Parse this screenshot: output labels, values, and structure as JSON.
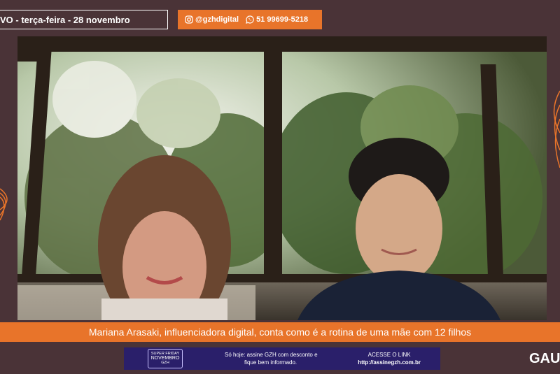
{
  "header": {
    "date_text": "VO - terça-feira - 28 novembro",
    "instagram_handle": "@gzhdigital",
    "whatsapp_number": "51 99699-5218",
    "icons": [
      "instagram-icon",
      "whatsapp-icon"
    ]
  },
  "caption": "Mariana Arasaki, influenciadora digital, conta como é a rotina de uma mãe com 12 filhos",
  "ad_banner": {
    "badge_lines": [
      "SUPER FRIDAY",
      "NOVEMBRO",
      "GZH"
    ],
    "offer_line1": "Só hoje: assine GZH com desconto e",
    "offer_line2": "fique bem informado.",
    "cta_label": "ACESSE O LINK",
    "cta_url": "http://assinegzh.com.br"
  },
  "logo_text": "GAU",
  "colors": {
    "background": "#4a3337",
    "accent": "#e8742a",
    "ad_background": "#2a1f6a"
  }
}
